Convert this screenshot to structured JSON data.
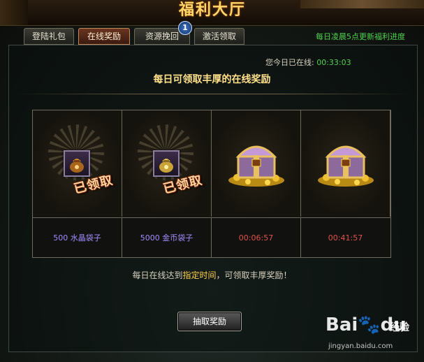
{
  "window": {
    "title": "福利大厅"
  },
  "tabs": [
    {
      "label": "登陆礼包",
      "active": false
    },
    {
      "label": "在线奖励",
      "active": true
    },
    {
      "label": "资源挽回",
      "active": false
    },
    {
      "label": "激活领取",
      "active": false
    }
  ],
  "badge": {
    "count": "1"
  },
  "update_note": "每日凌晨5点更新福利进度",
  "online": {
    "label": "您今日已在线:",
    "time": "00:33:03"
  },
  "headline": "每日可领取丰厚的在线奖励",
  "rewards": [
    {
      "icon": "crystal-bag-icon",
      "status": "已领取",
      "label": "500  水晶袋子",
      "color": "#a58cff"
    },
    {
      "icon": "gold-bag-icon",
      "status": "已领取",
      "label": "5000  金币袋子",
      "color": "#a58cff"
    },
    {
      "icon": "treasure-chest-icon",
      "status": "",
      "label": "00:06:57",
      "color": "#e0524b"
    },
    {
      "icon": "treasure-chest-icon",
      "status": "",
      "label": "00:41:57",
      "color": "#e0524b"
    }
  ],
  "hint": {
    "before": "每日在线达到",
    "highlight": "指定时间",
    "after": "，可领取丰厚奖励！"
  },
  "button": {
    "label": "抽取奖励"
  },
  "watermark": {
    "logo": "Bai",
    "paw": "du",
    "experience": "经验",
    "url": "jingyan.baidu.com"
  },
  "colors": {
    "accent_green": "#4fd14f",
    "title_gold": "#ffd76a",
    "timer_red": "#e0524b",
    "reward_purple": "#a58cff"
  }
}
